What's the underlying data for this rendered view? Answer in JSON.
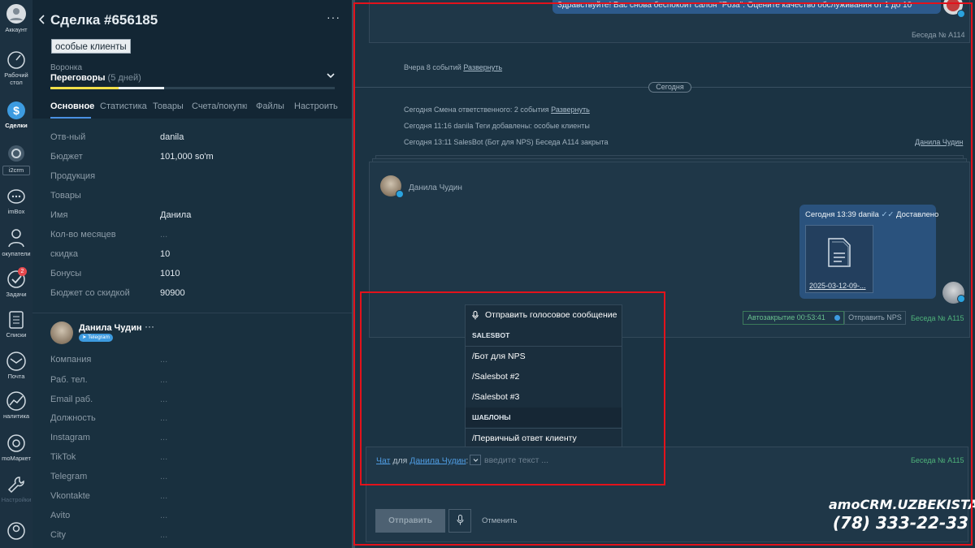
{
  "nav": {
    "account_label": "Аккаунт",
    "desk_label": "Рабочий стол",
    "deals_label": "Сделки",
    "i2crm_label": "i2crm",
    "imbox_label": "imBox",
    "buyers_label": "окупатели",
    "tasks_label": "Задачи",
    "tasks_badge": "2",
    "lists_label": "Списки",
    "mail_label": "Почта",
    "analytics_label": "налитика",
    "market_label": "moМаркет",
    "settings_label": "Настройки"
  },
  "card": {
    "title": "Сделка #656185",
    "tag": "особые клиенты",
    "funnel_label": "Воронка",
    "stage": "Переговоры",
    "stage_duration": "(5 дней)",
    "stage_progress": 0.4,
    "tabs": [
      "Основное",
      "Статистика",
      "Товары",
      "Счета/покупки",
      "Файлы",
      "Настроить"
    ],
    "fields": [
      {
        "label": "Отв-ный",
        "value": "danila"
      },
      {
        "label": "Бюджет",
        "value": "101,000 so'm"
      },
      {
        "label": "Продукция",
        "value": ""
      },
      {
        "label": "Товары",
        "value": ""
      },
      {
        "label": "Имя",
        "value": "Данила"
      },
      {
        "label": "Кол-во месяцев",
        "value": "..."
      },
      {
        "label": "скидка",
        "value": "10"
      },
      {
        "label": "Бонусы",
        "value": "1010"
      },
      {
        "label": "Бюджет со скидкой",
        "value": "90900"
      }
    ],
    "contact": {
      "name": "Данила Чудин",
      "messenger": "Telegram",
      "fields": [
        {
          "label": "Компания",
          "value": "..."
        },
        {
          "label": "Раб. тел.",
          "value": "..."
        },
        {
          "label": "Email раб.",
          "value": "..."
        },
        {
          "label": "Должность",
          "value": "..."
        },
        {
          "label": "Instagram",
          "value": "..."
        },
        {
          "label": "TikTok",
          "value": "..."
        },
        {
          "label": "Telegram",
          "value": "..."
        },
        {
          "label": "Vkontakte",
          "value": "..."
        },
        {
          "label": "Avito",
          "value": "..."
        },
        {
          "label": "City",
          "value": "..."
        }
      ]
    }
  },
  "feed": {
    "top_message": "Здравствуйте! Вас снова беспокоит салон \"Роза\". Оцените качество обслуживания от 1 до 10",
    "conv_a114": "Беседа № А114",
    "yesterday_events": "Вчера 8 событий",
    "expand": "Развернуть",
    "today_pill": "Сегодня",
    "event1": "Сегодня Смена ответственного: 2 события",
    "event2": "Сегодня 11:16 danila Теги добавлены: особые клиенты",
    "event3": "Сегодня 13:11 SalesBot (Бот для NPS) Беседа А114 закрыта",
    "event3_author": "Данила Чудин",
    "chat_contact": "Данила Чудин",
    "out_meta_time": "Сегодня 13:39 danila",
    "out_meta_status": "Доставлено",
    "file_name": "2025-03-12-09-...",
    "autoclose": "Автозакрытие 00:53:41",
    "send_nps": "Отправить NPS",
    "conv_a115": "Беседа № А115"
  },
  "dropdown": {
    "voice": "Отправить голосовое сообщение",
    "section_salesbot": "SALESBOT",
    "bots": [
      "/Бот для NPS",
      "/Salesbot #2",
      "/Salesbot #3"
    ],
    "section_templates": "ШАБЛОНЫ",
    "templates": [
      "/Первичный ответ клиенту"
    ]
  },
  "composer": {
    "mode": "Чат",
    "for_word": "для",
    "recipient": "Данила Чудин",
    "placeholder": "введите текст ...",
    "conv": "Беседа № А115",
    "send": "Отправить",
    "cancel": "Отменить"
  },
  "brand": {
    "line1": "amoCRM.UZBEKISTAN",
    "line2": "(78) 333-22-33"
  }
}
